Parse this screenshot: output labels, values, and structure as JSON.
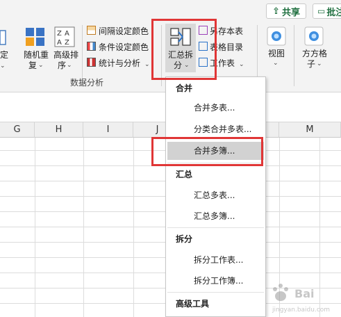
{
  "header": {
    "share_label": "共享",
    "comment_label": "批注"
  },
  "ribbon": {
    "partial_left_label": "定",
    "random_label_1": "随机重",
    "random_label_2": "复",
    "sort_label_1": "高级排",
    "sort_label_2": "序",
    "interval_color": "间隔设定颜色",
    "condition_color": "条件设定颜色",
    "stats_analysis": "统计与分析",
    "group_data_analysis": "数据分析",
    "summary_split_1": "汇总拆",
    "summary_split_2": "分",
    "save_table": "另存本表",
    "table_catalog": "表格目录",
    "worksheet": "工作表",
    "view_label": "视图",
    "grid_label_1": "方方格",
    "grid_label_2": "子"
  },
  "columns": [
    "G",
    "H",
    "I",
    "J",
    "M"
  ],
  "menu": {
    "sections": [
      {
        "title": "合并",
        "items": [
          "合并多表...",
          "分类合并多表...",
          "合并多簿..."
        ]
      },
      {
        "title": "汇总",
        "items": [
          "汇总多表...",
          "汇总多簿..."
        ]
      },
      {
        "title": "拆分",
        "items": [
          "拆分工作表...",
          "拆分工作簿..."
        ]
      },
      {
        "title": "高级工具",
        "items": []
      }
    ],
    "highlighted_item": "合并多簿..."
  },
  "colors": {
    "accent_red": "#e03636",
    "highlight": "#d2d2d2",
    "green": "#1f6f3f"
  }
}
